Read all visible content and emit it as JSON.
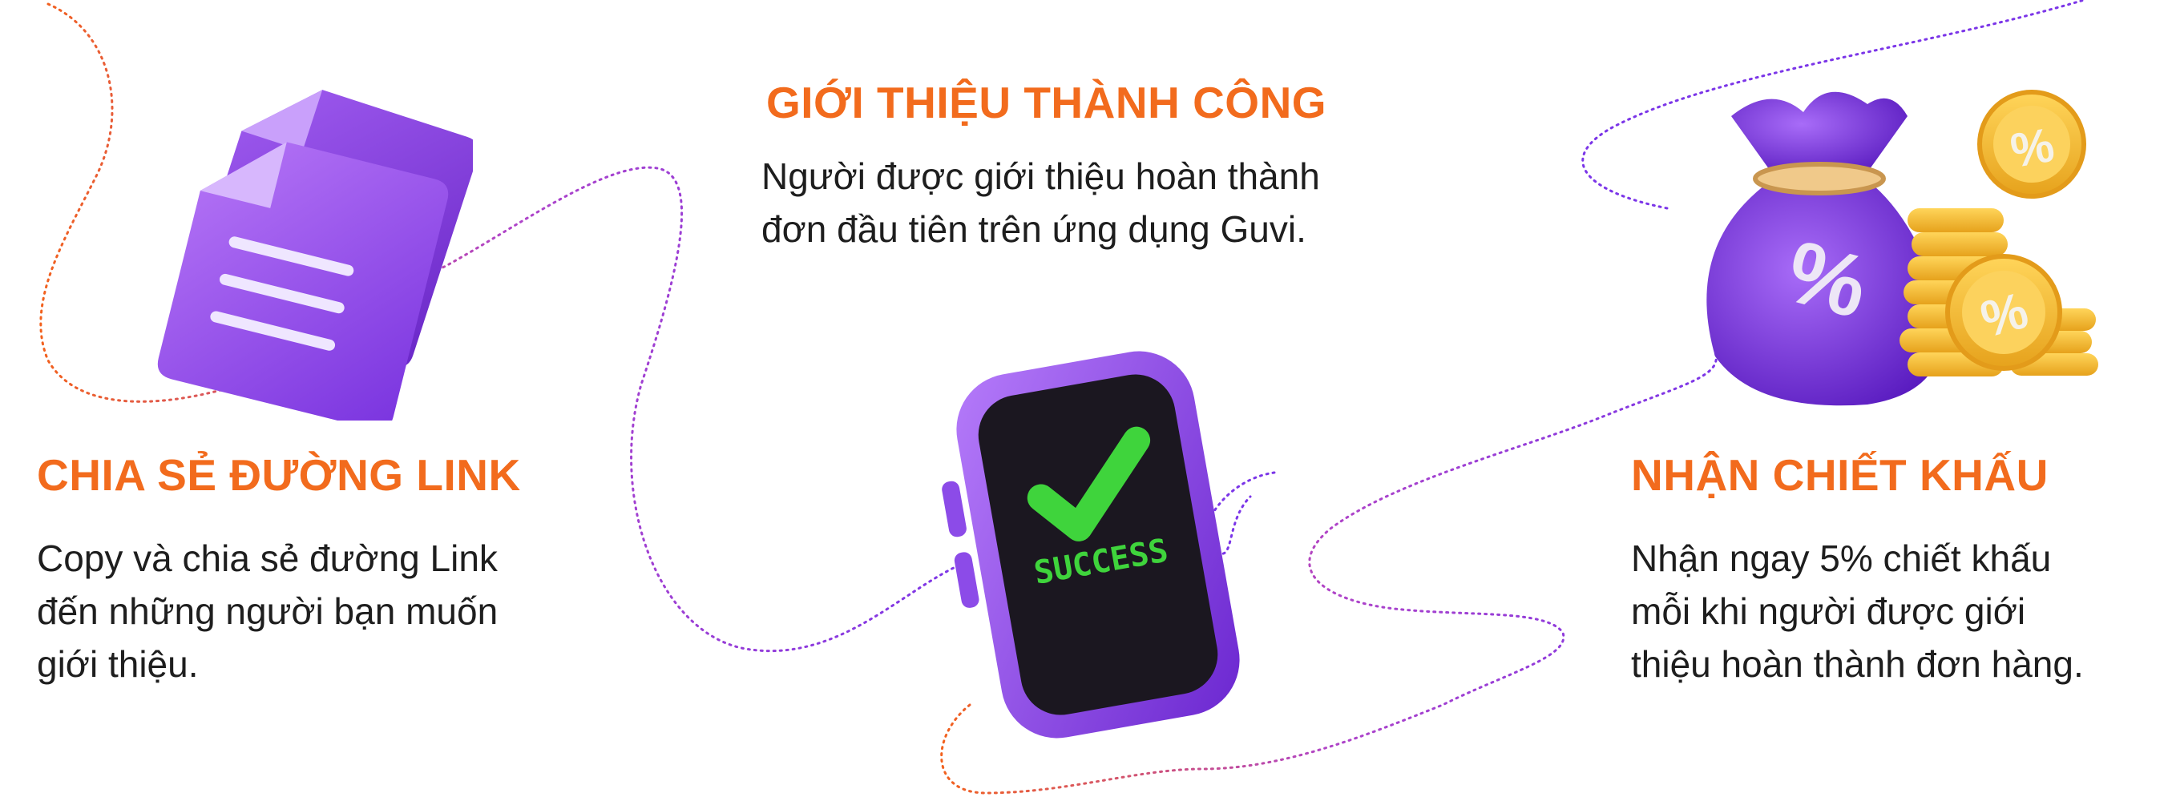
{
  "colors": {
    "title": "#f26b1d",
    "body_text": "#1e1e1e",
    "purple": "#8b3ee6",
    "path_orange": "#f2611d",
    "path_purple": "#7b35e8",
    "success_green": "#3fd43c",
    "coin_gold": "#f5b92e"
  },
  "steps": [
    {
      "title": "CHIA SẺ ĐƯỜNG LINK",
      "lines": [
        "Copy và chia sẻ đường Link",
        "đến những người bạn muốn",
        "giới thiệu."
      ],
      "icon": "document-stack-icon"
    },
    {
      "title": "GIỚI THIỆU THÀNH CÔNG",
      "lines": [
        "Người được giới thiệu hoàn thành",
        "đơn đầu tiên trên ứng dụng Guvi."
      ],
      "icon": "phone-success-icon"
    },
    {
      "title": "NHẬN CHIẾT KHẤU",
      "lines": [
        "Nhận ngay 5% chiết khấu",
        "mỗi khi người được giới",
        "thiệu hoàn thành đơn hàng."
      ],
      "icon": "money-bag-coins-icon"
    }
  ],
  "phone_screen": {
    "label": "SUCCESS"
  },
  "percent_symbol": "%"
}
